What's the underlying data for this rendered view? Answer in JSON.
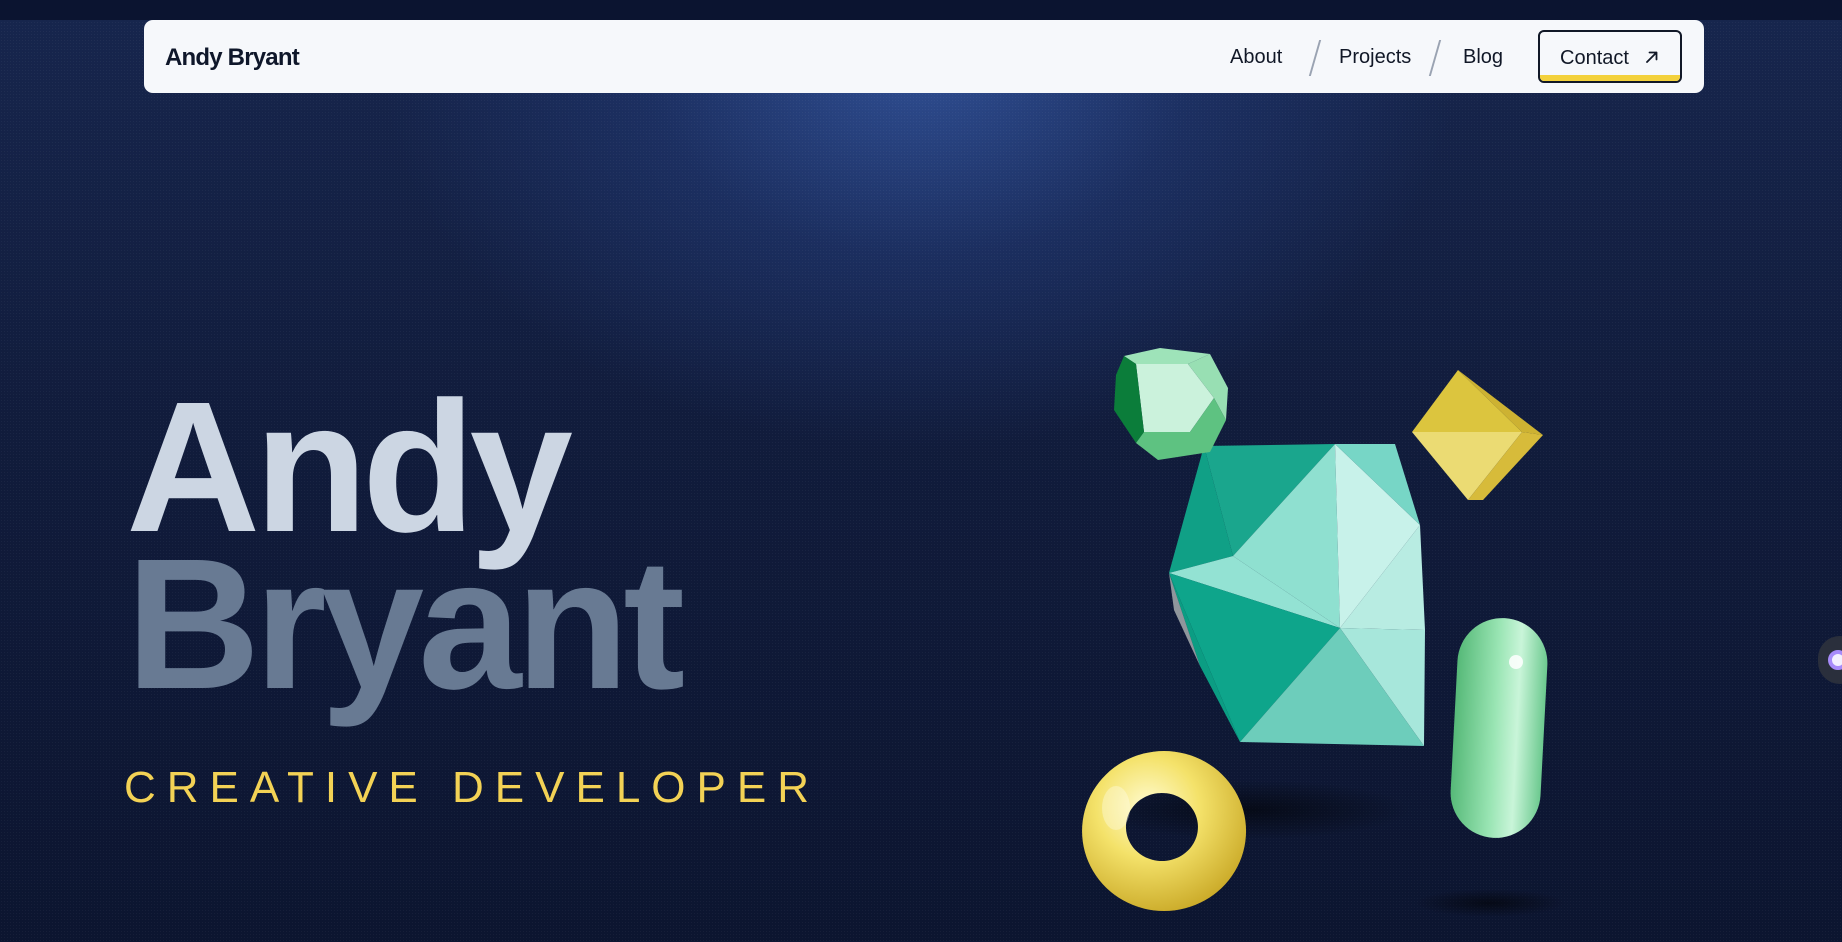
{
  "nav": {
    "brand": "Andy Bryant",
    "links": [
      {
        "label": "About"
      },
      {
        "label": "Projects"
      },
      {
        "label": "Blog"
      }
    ],
    "contact_label": "Contact",
    "contact_icon": "arrow-up-right-icon"
  },
  "hero": {
    "first_name": "Andy",
    "last_name": "Bryant",
    "tagline": "CREATIVE DEVELOPER"
  },
  "colors": {
    "accent_yellow": "#f3d255",
    "background_navy": "#111c3c",
    "name_light": "#ccd6e3",
    "name_muted": "#687a93",
    "shape_teal": "#5ecfbd",
    "shape_green": "#5bbf80"
  },
  "scene": {
    "shapes": [
      "green-dodecahedron",
      "yellow-octahedron",
      "teal-icosahedron",
      "yellow-torus",
      "green-capsule"
    ]
  }
}
